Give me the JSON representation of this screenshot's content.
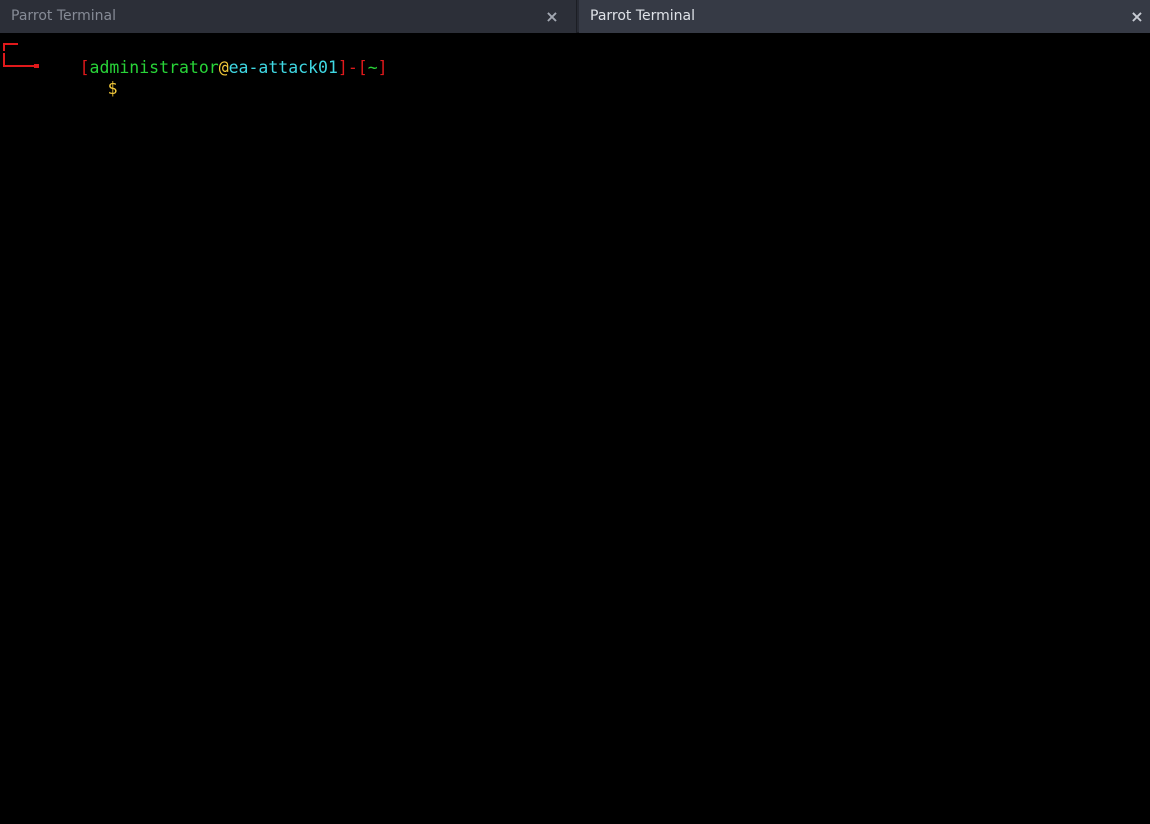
{
  "tabs": [
    {
      "label": "Parrot Terminal",
      "active": false,
      "close_glyph": "×"
    },
    {
      "label": "Parrot Terminal",
      "active": true,
      "close_glyph": "×"
    }
  ],
  "prompt": {
    "open_bracket": "[",
    "user": "administrator",
    "at": "@",
    "host": "ea-attack01",
    "close_bracket": "]",
    "dash": "-",
    "dir_open": "[",
    "dir": "~",
    "dir_close": "]",
    "symbol": "$"
  },
  "colors": {
    "prompt_frame": "#e0191b",
    "user": "#28d338",
    "at": "#f3c93a",
    "host": "#3fd8e3",
    "dir": "#28d338",
    "dollar": "#f3c93a",
    "background": "#000000",
    "tabbar": "#282b34"
  },
  "icons": {
    "tab_close": "close-icon",
    "prompt_corner": "prompt-corner-line"
  }
}
